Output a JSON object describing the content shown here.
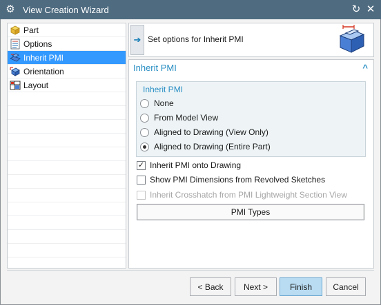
{
  "window": {
    "title": "View Creation Wizard"
  },
  "nav": {
    "items": [
      {
        "label": "Part",
        "icon": "part-icon"
      },
      {
        "label": "Options",
        "icon": "options-icon"
      },
      {
        "label": "Inherit PMI",
        "icon": "inherit-pmi-icon",
        "selected": true
      },
      {
        "label": "Orientation",
        "icon": "orientation-icon"
      },
      {
        "label": "Layout",
        "icon": "layout-icon"
      }
    ]
  },
  "header": {
    "text": "Set options for Inherit PMI"
  },
  "section": {
    "title": "Inherit PMI"
  },
  "group": {
    "label": "Inherit PMI",
    "options": [
      {
        "label": "None",
        "selected": false
      },
      {
        "label": "From Model View",
        "selected": false
      },
      {
        "label": "Aligned to Drawing (View Only)",
        "selected": false
      },
      {
        "label": "Aligned to Drawing (Entire Part)",
        "selected": true
      }
    ]
  },
  "checks": [
    {
      "label": "Inherit PMI onto Drawing",
      "checked": true,
      "enabled": true
    },
    {
      "label": "Show PMI Dimensions from Revolved Sketches",
      "checked": false,
      "enabled": true
    },
    {
      "label": "Inherit Crosshatch from PMI Lightweight Section View",
      "checked": false,
      "enabled": false
    }
  ],
  "pmi_types_button": "PMI Types",
  "buttons": {
    "back": "< Back",
    "next": "Next >",
    "finish": "Finish",
    "cancel": "Cancel"
  },
  "colors": {
    "titlebar": "#4e6b80",
    "accent": "#2a8fc4",
    "selection": "#3399ff",
    "finish_bg": "#b9dcf3"
  }
}
